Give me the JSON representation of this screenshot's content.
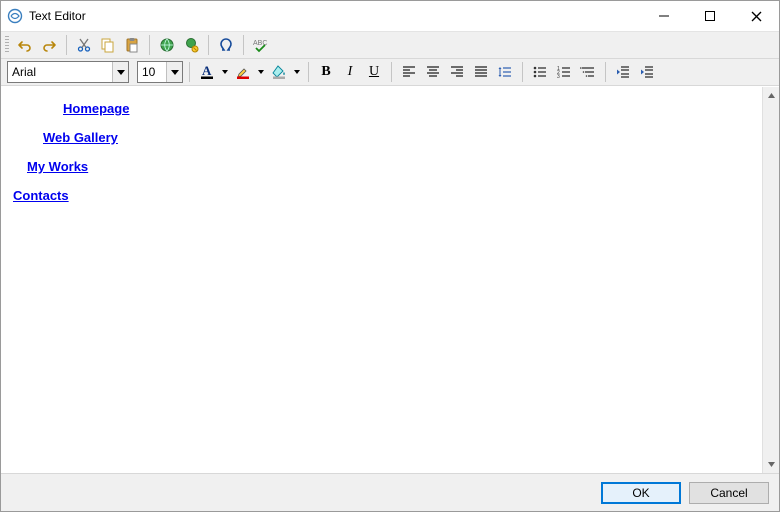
{
  "window": {
    "title": "Text Editor"
  },
  "toolbar2": {
    "font_name": "Arial",
    "font_size": "10"
  },
  "content": {
    "links": [
      "Homepage",
      "Web Gallery",
      "My Works",
      "Contacts"
    ]
  },
  "footer": {
    "ok": "OK",
    "cancel": "Cancel"
  }
}
